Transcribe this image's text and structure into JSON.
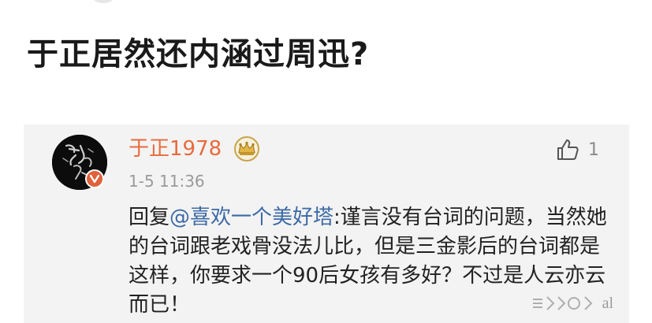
{
  "headline": "于正居然还内涵过周迅?",
  "comment": {
    "username": "于正1978",
    "timestamp": "1-5 11:36",
    "like_count": "1",
    "reply_prefix": "回复",
    "mention": "@喜欢一个美好塔",
    "reply_text": ":谨言没有台词的问题，当然她的台词跟老戏骨没法儿比，但是三金影后的台词都是这样，你要求一个90后女孩有多好？不过是人云亦云而已！"
  },
  "watermark": {
    "text": "al"
  },
  "colors": {
    "username": "#e86a3c",
    "mention": "#3c6aa6",
    "card_bg": "#f3f3f3",
    "badge": "#e0613a"
  },
  "icons": {
    "crown": "crown-icon",
    "like": "thumbs-up-icon",
    "verified": "verified-v-icon",
    "watermark": "watermark-icon"
  }
}
